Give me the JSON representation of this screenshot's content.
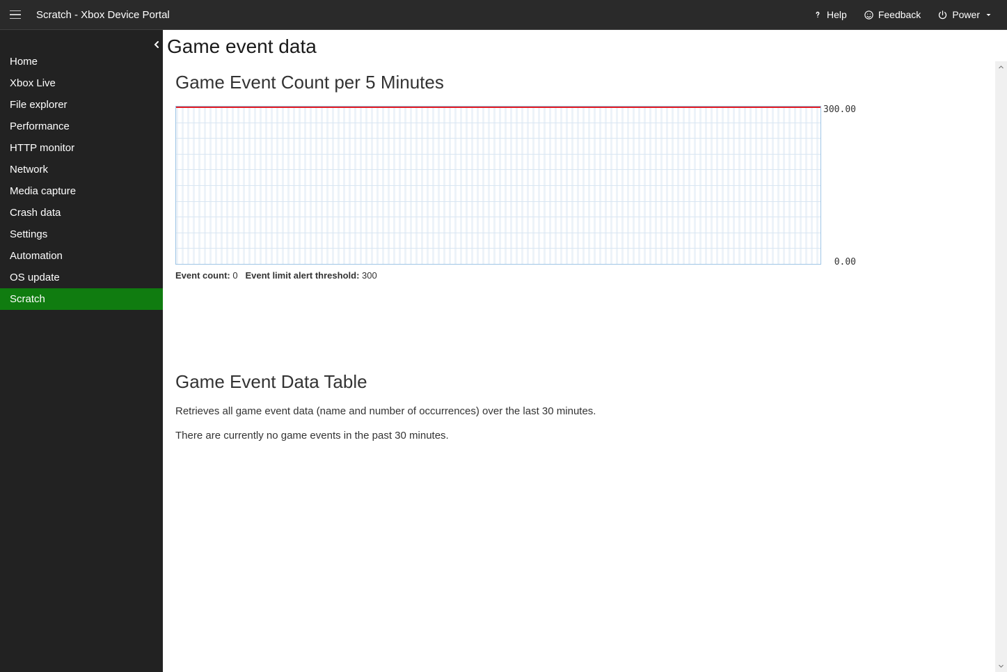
{
  "header": {
    "title": "Scratch - Xbox Device Portal",
    "help_label": "Help",
    "feedback_label": "Feedback",
    "power_label": "Power"
  },
  "sidebar": {
    "items": [
      {
        "label": "Home",
        "active": false
      },
      {
        "label": "Xbox Live",
        "active": false
      },
      {
        "label": "File explorer",
        "active": false
      },
      {
        "label": "Performance",
        "active": false
      },
      {
        "label": "HTTP monitor",
        "active": false
      },
      {
        "label": "Network",
        "active": false
      },
      {
        "label": "Media capture",
        "active": false
      },
      {
        "label": "Crash data",
        "active": false
      },
      {
        "label": "Settings",
        "active": false
      },
      {
        "label": "Automation",
        "active": false
      },
      {
        "label": "OS update",
        "active": false
      },
      {
        "label": "Scratch",
        "active": true
      }
    ]
  },
  "page": {
    "title": "Game event data",
    "chart_section_title": "Game Event Count per 5 Minutes",
    "event_count_label": "Event count:",
    "event_count_value": "0",
    "threshold_label": "Event limit alert threshold:",
    "threshold_value": "300",
    "ymax_label": "300.00",
    "ymin_label": "0.00",
    "table_section_title": "Game Event Data Table",
    "table_desc": "Retrieves all game event data (name and number of occurrences) over the last 30 minutes.",
    "table_empty": "There are currently no game events in the past 30 minutes."
  },
  "chart_data": {
    "type": "line",
    "title": "Game Event Count per 5 Minutes",
    "xlabel": "",
    "ylabel": "",
    "ylim": [
      0,
      300
    ],
    "threshold": 300,
    "series": [
      {
        "name": "Event count",
        "values": []
      }
    ],
    "current_value": 0
  }
}
